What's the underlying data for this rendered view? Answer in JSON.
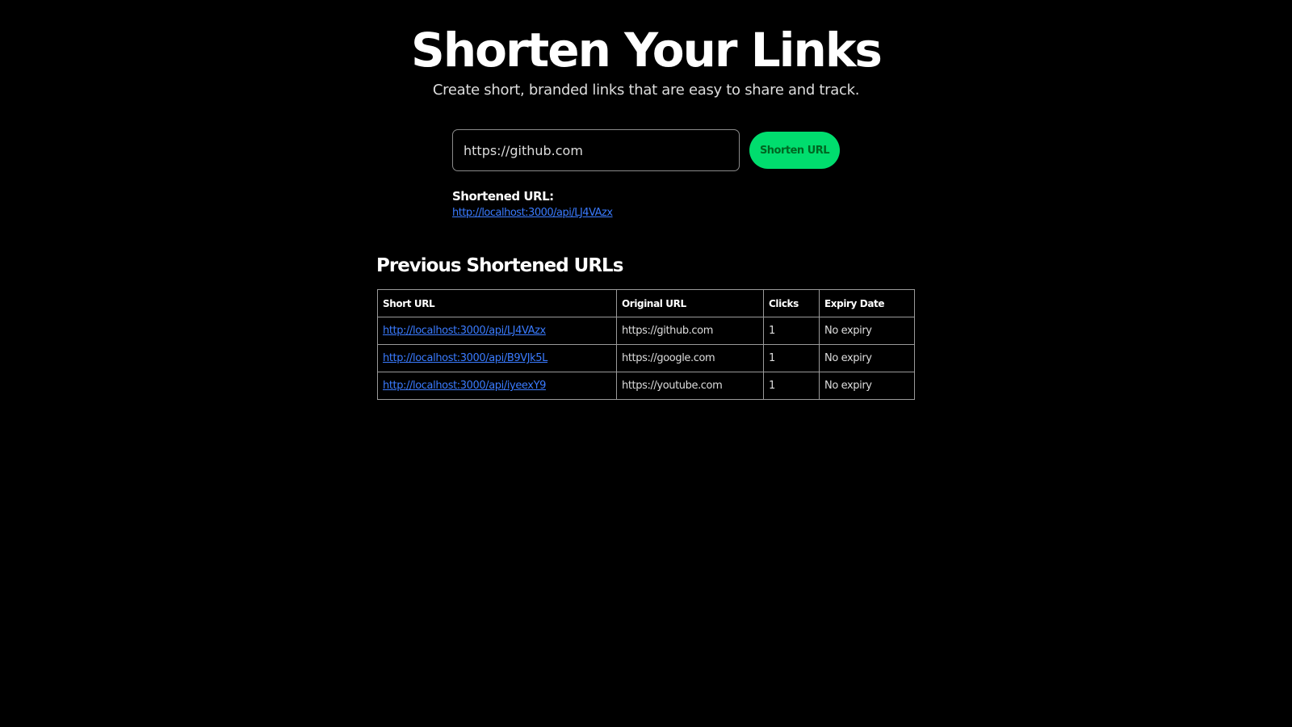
{
  "header": {
    "title": "Shorten Your Links",
    "subtitle": "Create short, branded links that are easy to share and track."
  },
  "form": {
    "url_value": "https://github.com",
    "button_label": "Shorten URL"
  },
  "result": {
    "label": "Shortened URL:",
    "link": "http://localhost:3000/api/LJ4VAzx"
  },
  "history": {
    "heading": "Previous Shortened URLs",
    "columns": [
      "Short URL",
      "Original URL",
      "Clicks",
      "Expiry Date"
    ],
    "rows": [
      {
        "short": "http://localhost:3000/api/LJ4VAzx",
        "original": "https://github.com",
        "clicks": "1",
        "expiry": "No expiry"
      },
      {
        "short": "http://localhost:3000/api/B9VJk5L",
        "original": "https://google.com",
        "clicks": "1",
        "expiry": "No expiry"
      },
      {
        "short": "http://localhost:3000/api/iyeexY9",
        "original": "https://youtube.com",
        "clicks": "1",
        "expiry": "No expiry"
      }
    ]
  },
  "colors": {
    "accent": "#00dd6e",
    "link": "#3a7bff",
    "background": "#000000"
  }
}
